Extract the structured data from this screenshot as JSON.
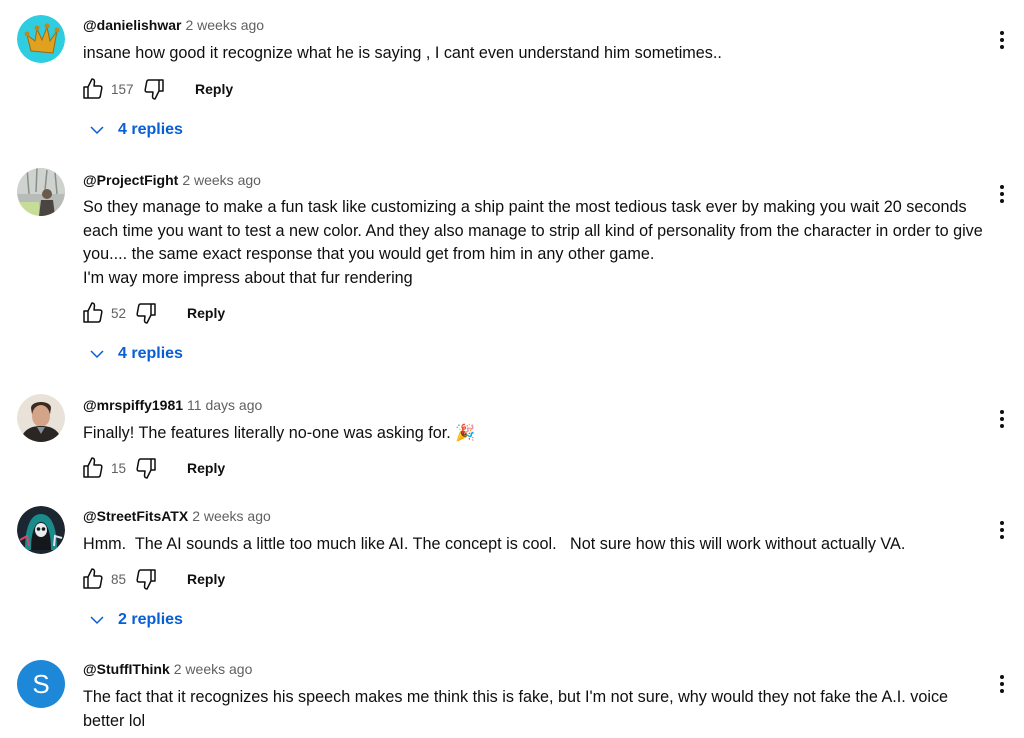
{
  "colors": {
    "link_blue": "#065fd4",
    "meta_gray": "#606060",
    "text": "#0f0f0f",
    "letter_avatar_bg": "#1e88d8"
  },
  "reply_label": "Reply",
  "comments": [
    {
      "author": "@danielishwar",
      "time": "2 weeks ago",
      "avatar": "crown-avatar",
      "text": "insane how good it recognize what he is saying , I cant even understand him sometimes..",
      "likes": "157",
      "replies": "4 replies"
    },
    {
      "author": "@ProjectFight",
      "time": "2 weeks ago",
      "avatar": "photo-avatar-outdoor",
      "text": "So they manage to make a fun task like customizing a ship paint the most tedious task ever by making you wait 20 seconds each time you want to test a new color. And they also manage to strip all kind of personality from the character in order to give you.... the same exact response that you would get from him in any other game.\nI'm way more impress about that fur rendering",
      "likes": "52",
      "replies": "4 replies"
    },
    {
      "author": "@mrspiffy1981",
      "time": "11 days ago",
      "avatar": "photo-avatar-man",
      "text": "Finally! The features literally no-one was asking for. 🎉",
      "likes": "15",
      "replies": null
    },
    {
      "author": "@StreetFitsATX",
      "time": "2 weeks ago",
      "avatar": "skull-hood-avatar",
      "text": "Hmm.  The AI sounds a little too much like AI. The concept is cool.   Not sure how this will work without actually VA.",
      "likes": "85",
      "replies": "2 replies"
    },
    {
      "author": "@StuffIThink",
      "time": "2 weeks ago",
      "avatar": "letter-avatar",
      "avatar_letter": "S",
      "text": "The fact that it recognizes his speech makes me think this is fake, but I'm not sure, why would they not fake the A.I. voice better lol",
      "likes": null,
      "replies": null
    }
  ]
}
